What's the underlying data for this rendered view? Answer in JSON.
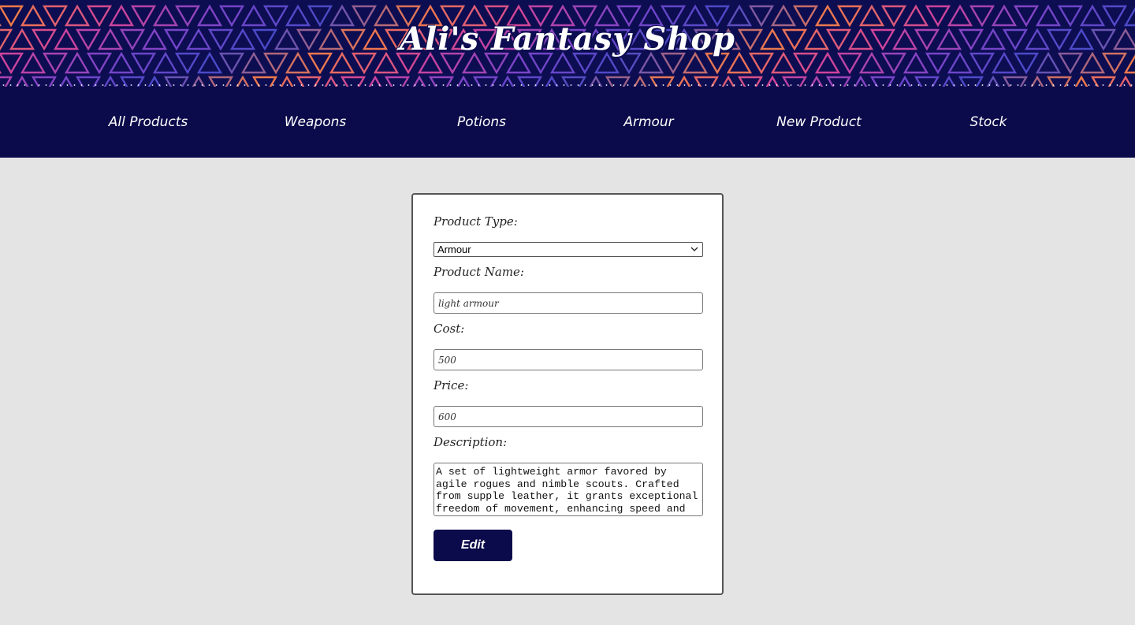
{
  "header": {
    "title": "Ali's Fantasy Shop"
  },
  "nav": {
    "items": [
      {
        "label": "All Products"
      },
      {
        "label": "Weapons"
      },
      {
        "label": "Potions"
      },
      {
        "label": "Armour"
      },
      {
        "label": "New Product"
      },
      {
        "label": "Stock"
      }
    ]
  },
  "form": {
    "product_type": {
      "label": "Product Type:",
      "value": "Armour"
    },
    "product_name": {
      "label": "Product Name:",
      "value": "light armour"
    },
    "cost": {
      "label": "Cost:",
      "value": "500"
    },
    "price": {
      "label": "Price:",
      "value": "600"
    },
    "description": {
      "label": "Description:",
      "value": "A set of lightweight armor favored by agile rogues and nimble scouts. Crafted from supple leather, it grants exceptional freedom of movement, enhancing speed and"
    },
    "submit_label": "Edit"
  },
  "colors": {
    "banner_bg": "#0d0d52",
    "nav_bg": "#0b0a4a",
    "page_bg": "#e4e4e4",
    "button_bg": "#0b0a4a",
    "pattern_stops": [
      "#f07a4a",
      "#d0449a",
      "#7a44c8",
      "#4a4ac8"
    ]
  }
}
